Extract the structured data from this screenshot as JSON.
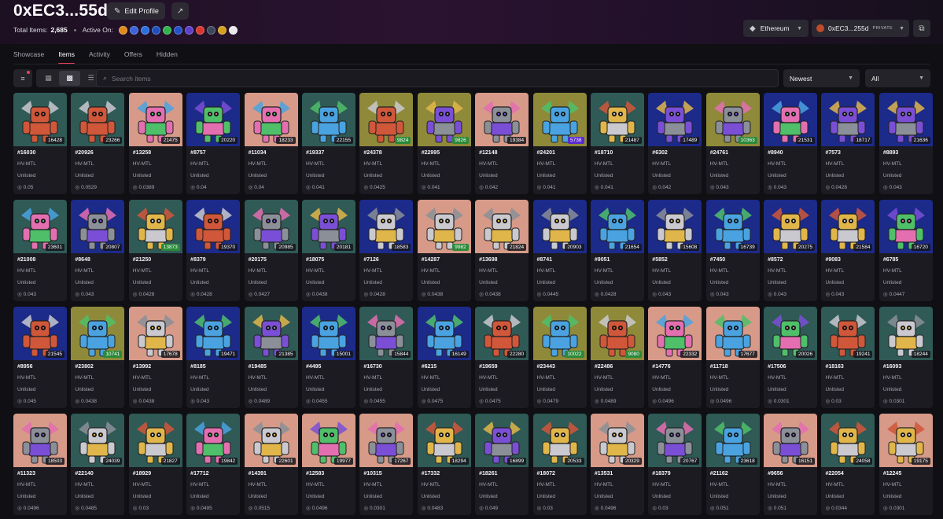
{
  "profile": {
    "address": "0xEC3...55d",
    "edit_label": "Edit Profile",
    "total_items_label": "Total Items:",
    "total_items": "2,685",
    "active_on_label": "Active On:",
    "chain_icons": [
      {
        "name": "coin-icon-1",
        "color": "#e08a1e"
      },
      {
        "name": "coin-icon-2",
        "color": "#3b62d9"
      },
      {
        "name": "coin-icon-3",
        "color": "#2b6fe0"
      },
      {
        "name": "coin-icon-4",
        "color": "#1f4fbf"
      },
      {
        "name": "coin-icon-5",
        "color": "#2fb34a"
      },
      {
        "name": "coin-icon-6",
        "color": "#2451c8"
      },
      {
        "name": "coin-icon-7",
        "color": "#5b3fc9"
      },
      {
        "name": "coin-icon-8",
        "color": "#d9372b"
      },
      {
        "name": "coin-icon-9",
        "color": "#39475a"
      },
      {
        "name": "coin-icon-10",
        "color": "#d6a01e"
      },
      {
        "name": "coin-icon-11",
        "color": "#e8e8ee"
      }
    ]
  },
  "network": {
    "label": "Ethereum"
  },
  "wallet": {
    "label": "0xEC3...255d",
    "tag": "PRIVATE"
  },
  "tabs": [
    {
      "label": "Showcase",
      "active": false
    },
    {
      "label": "Items",
      "active": true
    },
    {
      "label": "Activity",
      "active": false
    },
    {
      "label": "Offers",
      "active": false
    },
    {
      "label": "Hidden",
      "active": false
    }
  ],
  "search": {
    "placeholder": "Search items"
  },
  "sort": {
    "selected": "Newest"
  },
  "filter": {
    "selected": "All"
  },
  "colors": {
    "accent": "#e8435d"
  },
  "items": [
    {
      "id": "#16030",
      "collection": "HV-MTL",
      "status": "Unlisted",
      "price": "0.05",
      "num": "16428",
      "bg": "#2f5a56",
      "badge": "dark"
    },
    {
      "id": "#20926",
      "collection": "HV-MTL",
      "status": "Unlisted",
      "price": "0.0529",
      "num": "23266",
      "bg": "#2f5a56",
      "badge": "dark"
    },
    {
      "id": "#13258",
      "collection": "HV-MTL",
      "status": "Unlisted",
      "price": "0.0389",
      "num": "21475",
      "bg": "#d79a88",
      "badge": "dark"
    },
    {
      "id": "#8757",
      "collection": "HV-MTL",
      "status": "Unlisted",
      "price": "0.04",
      "num": "20220",
      "bg": "#1c2a8a",
      "badge": "dark"
    },
    {
      "id": "#11034",
      "collection": "HV-MTL",
      "status": "Unlisted",
      "price": "0.04",
      "num": "18233",
      "bg": "#d79a88",
      "badge": "dark"
    },
    {
      "id": "#19337",
      "collection": "HV-MTL",
      "status": "Unlisted",
      "price": "0.041",
      "num": "22155",
      "bg": "#2f5a56",
      "badge": "dark"
    },
    {
      "id": "#24378",
      "collection": "HV-MTL",
      "status": "Unlisted",
      "price": "0.0425",
      "num": "9824",
      "bg": "#8f8a3a",
      "badge": "green"
    },
    {
      "id": "#22995",
      "collection": "HV-MTL",
      "status": "Unlisted",
      "price": "0.041",
      "num": "9826",
      "bg": "#8f8a3a",
      "badge": "green"
    },
    {
      "id": "#12148",
      "collection": "HV-MTL",
      "status": "Unlisted",
      "price": "0.042",
      "num": "19384",
      "bg": "#d79a88",
      "badge": "dark"
    },
    {
      "id": "#24201",
      "collection": "HV-MTL",
      "status": "Unlisted",
      "price": "0.041",
      "num": "5738",
      "bg": "#8f8a3a",
      "badge": "purple"
    },
    {
      "id": "#18710",
      "collection": "HV-MTL",
      "status": "Unlisted",
      "price": "0.041",
      "num": "21487",
      "bg": "#2f5a56",
      "badge": "dark"
    },
    {
      "id": "#6302",
      "collection": "HV-MTL",
      "status": "Unlisted",
      "price": "0.042",
      "num": "17489",
      "bg": "#1c2a8a",
      "badge": "dark"
    },
    {
      "id": "#24761",
      "collection": "HV-MTL",
      "status": "Unlisted",
      "price": "0.043",
      "num": "10363",
      "bg": "#8f8a3a",
      "badge": "green"
    },
    {
      "id": "#8940",
      "collection": "HV-MTL",
      "status": "Unlisted",
      "price": "0.043",
      "num": "21531",
      "bg": "#1c2a8a",
      "badge": "dark"
    },
    {
      "id": "#7573",
      "collection": "HV-MTL",
      "status": "Unlisted",
      "price": "0.0428",
      "num": "18717",
      "bg": "#1c2a8a",
      "badge": "dark"
    },
    {
      "id": "#8893",
      "collection": "HV-MTL",
      "status": "Unlisted",
      "price": "0.043",
      "num": "21636",
      "bg": "#1c2a8a",
      "badge": "dark"
    },
    {
      "id": "#21008",
      "collection": "HV-MTL",
      "status": "Unlisted",
      "price": "0.043",
      "num": "23601",
      "bg": "#2f5a56",
      "badge": "dark"
    },
    {
      "id": "#8648",
      "collection": "HV-MTL",
      "status": "Unlisted",
      "price": "0.043",
      "num": "20807",
      "bg": "#1c2a8a",
      "badge": "dark"
    },
    {
      "id": "#21250",
      "collection": "HV-MTL",
      "status": "Unlisted",
      "price": "0.0428",
      "num": "13873",
      "bg": "#2f5a56",
      "badge": "green"
    },
    {
      "id": "#8379",
      "collection": "HV-MTL",
      "status": "Unlisted",
      "price": "0.0428",
      "num": "19370",
      "bg": "#1c2a8a",
      "badge": "dark"
    },
    {
      "id": "#20175",
      "collection": "HV-MTL",
      "status": "Unlisted",
      "price": "0.0427",
      "num": "20985",
      "bg": "#2f5a56",
      "badge": "dark"
    },
    {
      "id": "#18075",
      "collection": "HV-MTL",
      "status": "Unlisted",
      "price": "0.0438",
      "num": "20181",
      "bg": "#2f5a56",
      "badge": "dark"
    },
    {
      "id": "#7126",
      "collection": "HV-MTL",
      "status": "Unlisted",
      "price": "0.0428",
      "num": "18583",
      "bg": "#1c2a8a",
      "badge": "dark"
    },
    {
      "id": "#14287",
      "collection": "HV-MTL",
      "status": "Unlisted",
      "price": "0.0438",
      "num": "9982",
      "bg": "#d79a88",
      "badge": "green"
    },
    {
      "id": "#13698",
      "collection": "HV-MTL",
      "status": "Unlisted",
      "price": "0.0438",
      "num": "21824",
      "bg": "#d79a88",
      "badge": "dark"
    },
    {
      "id": "#8741",
      "collection": "HV-MTL",
      "status": "Unlisted",
      "price": "0.0445",
      "num": "20903",
      "bg": "#1c2a8a",
      "badge": "dark"
    },
    {
      "id": "#9051",
      "collection": "HV-MTL",
      "status": "Unlisted",
      "price": "0.0428",
      "num": "21654",
      "bg": "#1c2a8a",
      "badge": "dark"
    },
    {
      "id": "#5852",
      "collection": "HV-MTL",
      "status": "Unlisted",
      "price": "0.043",
      "num": "15608",
      "bg": "#1c2a8a",
      "badge": "dark"
    },
    {
      "id": "#7450",
      "collection": "HV-MTL",
      "status": "Unlisted",
      "price": "0.043",
      "num": "16739",
      "bg": "#1c2a8a",
      "badge": "dark"
    },
    {
      "id": "#8572",
      "collection": "HV-MTL",
      "status": "Unlisted",
      "price": "0.043",
      "num": "20275",
      "bg": "#1c2a8a",
      "badge": "dark"
    },
    {
      "id": "#9083",
      "collection": "HV-MTL",
      "status": "Unlisted",
      "price": "0.043",
      "num": "21584",
      "bg": "#1c2a8a",
      "badge": "dark"
    },
    {
      "id": "#6785",
      "collection": "HV-MTL",
      "status": "Unlisted",
      "price": "0.0447",
      "num": "16720",
      "bg": "#1c2a8a",
      "badge": "dark"
    },
    {
      "id": "#8956",
      "collection": "HV-MTL",
      "status": "Unlisted",
      "price": "0.045",
      "num": "21545",
      "bg": "#1c2a8a",
      "badge": "dark"
    },
    {
      "id": "#23802",
      "collection": "HV-MTL",
      "status": "Unlisted",
      "price": "0.0438",
      "num": "10741",
      "bg": "#8f8a3a",
      "badge": "green"
    },
    {
      "id": "#13992",
      "collection": "HV-MTL",
      "status": "Unlisted",
      "price": "0.0438",
      "num": "17678",
      "bg": "#d79a88",
      "badge": "dark"
    },
    {
      "id": "#8185",
      "collection": "HV-MTL",
      "status": "Unlisted",
      "price": "0.043",
      "num": "19471",
      "bg": "#1c2a8a",
      "badge": "dark"
    },
    {
      "id": "#19485",
      "collection": "HV-MTL",
      "status": "Unlisted",
      "price": "0.0489",
      "num": "21385",
      "bg": "#2f5a56",
      "badge": "dark"
    },
    {
      "id": "#4495",
      "collection": "HV-MTL",
      "status": "Unlisted",
      "price": "0.0455",
      "num": "15001",
      "bg": "#1c2a8a",
      "badge": "dark"
    },
    {
      "id": "#16730",
      "collection": "HV-MTL",
      "status": "Unlisted",
      "price": "0.0455",
      "num": "15844",
      "bg": "#2f5a56",
      "badge": "dark"
    },
    {
      "id": "#6215",
      "collection": "HV-MTL",
      "status": "Unlisted",
      "price": "0.0475",
      "num": "16149",
      "bg": "#1c2a8a",
      "badge": "dark"
    },
    {
      "id": "#19659",
      "collection": "HV-MTL",
      "status": "Unlisted",
      "price": "0.0475",
      "num": "22280",
      "bg": "#2f5a56",
      "badge": "dark"
    },
    {
      "id": "#23443",
      "collection": "HV-MTL",
      "status": "Unlisted",
      "price": "0.0479",
      "num": "10022",
      "bg": "#8f8a3a",
      "badge": "green"
    },
    {
      "id": "#22486",
      "collection": "HV-MTL",
      "status": "Unlisted",
      "price": "0.0489",
      "num": "9080",
      "bg": "#8f8a3a",
      "badge": "green"
    },
    {
      "id": "#14776",
      "collection": "HV-MTL",
      "status": "Unlisted",
      "price": "0.0496",
      "num": "22332",
      "bg": "#d79a88",
      "badge": "dark"
    },
    {
      "id": "#11718",
      "collection": "HV-MTL",
      "status": "Unlisted",
      "price": "0.0496",
      "num": "17677",
      "bg": "#d79a88",
      "badge": "dark"
    },
    {
      "id": "#17506",
      "collection": "HV-MTL",
      "status": "Unlisted",
      "price": "0.0301",
      "num": "20026",
      "bg": "#2f5a56",
      "badge": "dark"
    },
    {
      "id": "#18163",
      "collection": "HV-MTL",
      "status": "Unlisted",
      "price": "0.03",
      "num": "19241",
      "bg": "#2f5a56",
      "badge": "dark"
    },
    {
      "id": "#16093",
      "collection": "HV-MTL",
      "status": "Unlisted",
      "price": "0.0301",
      "num": "18244",
      "bg": "#2f5a56",
      "badge": "dark"
    },
    {
      "id": "#11323",
      "collection": "HV-MTL",
      "status": "Unlisted",
      "price": "0.0496",
      "num": "18503",
      "bg": "#d79a88",
      "badge": "dark"
    },
    {
      "id": "#22140",
      "collection": "HV-MTL",
      "status": "Unlisted",
      "price": "0.0485",
      "num": "24039",
      "bg": "#2f5a56",
      "badge": "dark"
    },
    {
      "id": "#18929",
      "collection": "HV-MTL",
      "status": "Unlisted",
      "price": "0.03",
      "num": "21827",
      "bg": "#2f5a56",
      "badge": "dark"
    },
    {
      "id": "#17712",
      "collection": "HV-MTL",
      "status": "Unlisted",
      "price": "0.0495",
      "num": "19842",
      "bg": "#2f5a56",
      "badge": "dark"
    },
    {
      "id": "#14391",
      "collection": "HV-MTL",
      "status": "Unlisted",
      "price": "0.0515",
      "num": "22601",
      "bg": "#d79a88",
      "badge": "dark"
    },
    {
      "id": "#12583",
      "collection": "HV-MTL",
      "status": "Unlisted",
      "price": "0.0496",
      "num": "19977",
      "bg": "#d79a88",
      "badge": "dark"
    },
    {
      "id": "#10315",
      "collection": "HV-MTL",
      "status": "Unlisted",
      "price": "0.0301",
      "num": "17267",
      "bg": "#d79a88",
      "badge": "dark"
    },
    {
      "id": "#17332",
      "collection": "HV-MTL",
      "status": "Unlisted",
      "price": "0.0483",
      "num": "18294",
      "bg": "#2f5a56",
      "badge": "dark"
    },
    {
      "id": "#18261",
      "collection": "HV-MTL",
      "status": "Unlisted",
      "price": "0.049",
      "num": "16899",
      "bg": "#2f5a56",
      "badge": "dark"
    },
    {
      "id": "#18072",
      "collection": "HV-MTL",
      "status": "Unlisted",
      "price": "0.03",
      "num": "20533",
      "bg": "#2f5a56",
      "badge": "dark"
    },
    {
      "id": "#13531",
      "collection": "HV-MTL",
      "status": "Unlisted",
      "price": "0.0496",
      "num": "20329",
      "bg": "#d79a88",
      "badge": "dark"
    },
    {
      "id": "#18379",
      "collection": "HV-MTL",
      "status": "Unlisted",
      "price": "0.03",
      "num": "20767",
      "bg": "#2f5a56",
      "badge": "dark"
    },
    {
      "id": "#21162",
      "collection": "HV-MTL",
      "status": "Unlisted",
      "price": "0.051",
      "num": "23618",
      "bg": "#2f5a56",
      "badge": "dark"
    },
    {
      "id": "#9656",
      "collection": "HV-MTL",
      "status": "Unlisted",
      "price": "0.051",
      "num": "16151",
      "bg": "#d79a88",
      "badge": "dark"
    },
    {
      "id": "#22054",
      "collection": "HV-MTL",
      "status": "Unlisted",
      "price": "0.0344",
      "num": "24058",
      "bg": "#2f5a56",
      "badge": "dark"
    },
    {
      "id": "#12245",
      "collection": "HV-MTL",
      "status": "Unlisted",
      "price": "0.0301",
      "num": "19175",
      "bg": "#d79a88",
      "badge": "dark"
    }
  ]
}
